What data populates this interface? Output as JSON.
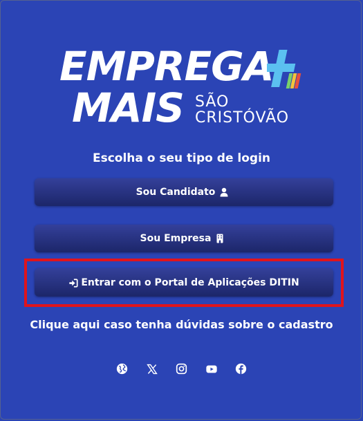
{
  "logo": {
    "line1": "EMPREGA",
    "line2": "MAIS",
    "city_line1": "SÃO",
    "city_line2": "CRISTÓVÃO"
  },
  "subtitle": "Escolha o seu tipo de login",
  "buttons": {
    "candidato": {
      "label": "Sou Candidato",
      "icon": "user-icon"
    },
    "empresa": {
      "label": "Sou Empresa",
      "icon": "building-icon"
    },
    "ditin": {
      "label": "Entrar com o Portal de Aplicações DITIN",
      "icon": "sign-in-icon"
    }
  },
  "help_link": "Clique aqui caso tenha dúvidas sobre o cadastro",
  "social": [
    {
      "icon": "globe-icon"
    },
    {
      "icon": "x-twitter-icon"
    },
    {
      "icon": "instagram-icon"
    },
    {
      "icon": "youtube-icon"
    },
    {
      "icon": "facebook-icon"
    }
  ],
  "colors": {
    "background": "#2b44b5",
    "button": "#232e7a",
    "highlight": "#e0141c",
    "plus_blue": "#5bc0f0",
    "plus_green": "#7ad06a",
    "plus_yellow": "#f3c43a",
    "plus_red": "#e8503c"
  }
}
